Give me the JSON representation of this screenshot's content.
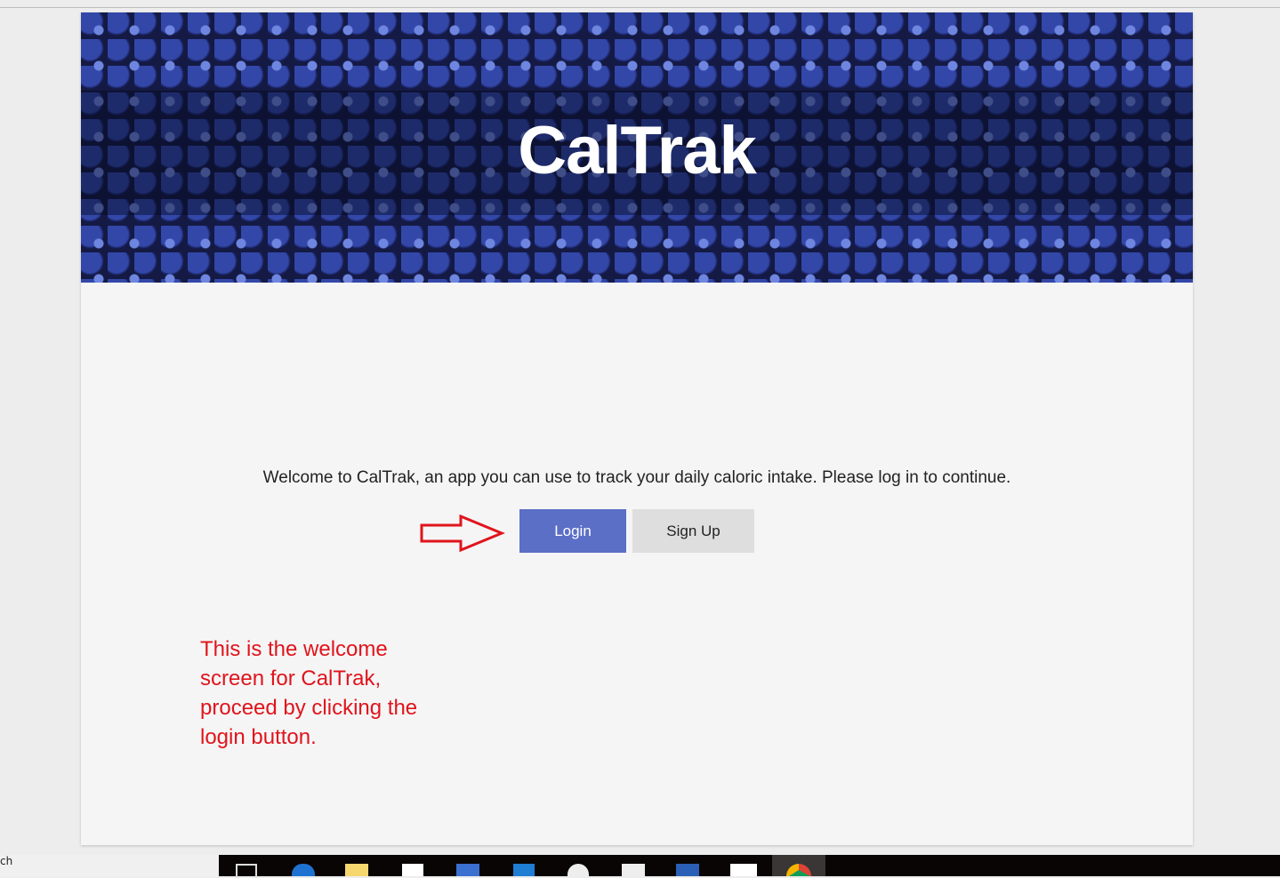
{
  "app": {
    "title": "CalTrak"
  },
  "main": {
    "welcome_text": "Welcome to CalTrak, an app you can use to track your daily caloric intake. Please log in to continue.",
    "login_label": "Login",
    "signup_label": "Sign Up"
  },
  "annotation": {
    "note": "This is the welcome screen for CalTrak, proceed by clicking the login button.",
    "color": "#e0141c"
  },
  "colors": {
    "login_button": "#5b6fc6",
    "signup_button": "#dedede"
  },
  "taskbar": {
    "search_text": "ch",
    "icons": [
      "task-view-icon",
      "edge-icon",
      "file-explorer-icon",
      "store-icon",
      "powershell-icon",
      "vscode-icon",
      "settings-icon",
      "calendar-icon",
      "word-icon",
      "mail-icon",
      "chrome-icon"
    ]
  }
}
